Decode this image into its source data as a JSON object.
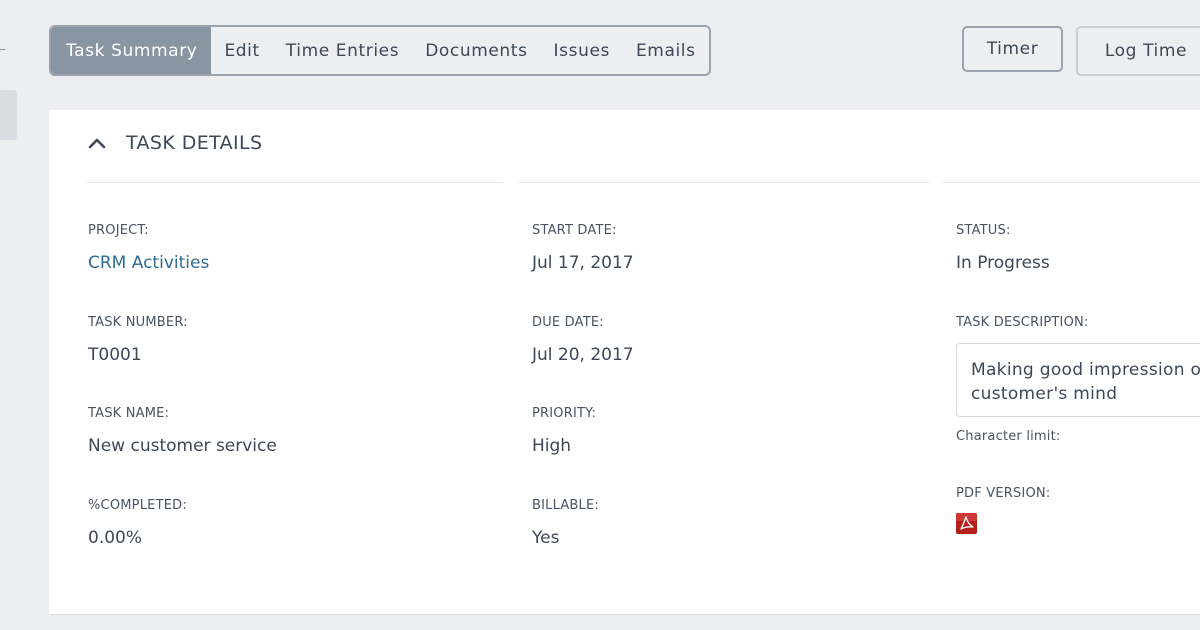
{
  "tabs": [
    {
      "label": "Task Summary",
      "active": true
    },
    {
      "label": "Edit",
      "active": false
    },
    {
      "label": "Time Entries",
      "active": false
    },
    {
      "label": "Documents",
      "active": false
    },
    {
      "label": "Issues",
      "active": false
    },
    {
      "label": "Emails",
      "active": false
    }
  ],
  "actions": {
    "timer_label": "Timer",
    "log_time_label": "Log Time"
  },
  "section": {
    "title": "TASK DETAILS",
    "icon": "chevron-up-icon"
  },
  "fields": {
    "project": {
      "label": "PROJECT:",
      "value": "CRM Activities"
    },
    "task_number": {
      "label": "TASK NUMBER:",
      "value": "T0001"
    },
    "task_name": {
      "label": "TASK NAME:",
      "value": "New customer service"
    },
    "completed": {
      "label": "%COMPLETED:",
      "value": "0.00%"
    },
    "start_date": {
      "label": "START DATE:",
      "value": "Jul 17, 2017"
    },
    "due_date": {
      "label": "DUE DATE:",
      "value": "Jul 20, 2017"
    },
    "priority": {
      "label": "PRIORITY:",
      "value": "High"
    },
    "billable": {
      "label": "BILLABLE:",
      "value": "Yes"
    },
    "status": {
      "label": "STATUS:",
      "value": "In Progress"
    },
    "task_description": {
      "label": "TASK DESCRIPTION:",
      "line1": "Making good impression on",
      "line2": "customer's mind"
    },
    "character_limit": {
      "label": "Character limit:"
    },
    "pdf_version": {
      "label": "PDF VERSION:",
      "icon": "pdf-icon"
    }
  },
  "colors": {
    "active_tab": "#8a95a3",
    "link": "#2f6b94",
    "pdf_red": "#b3201c"
  }
}
